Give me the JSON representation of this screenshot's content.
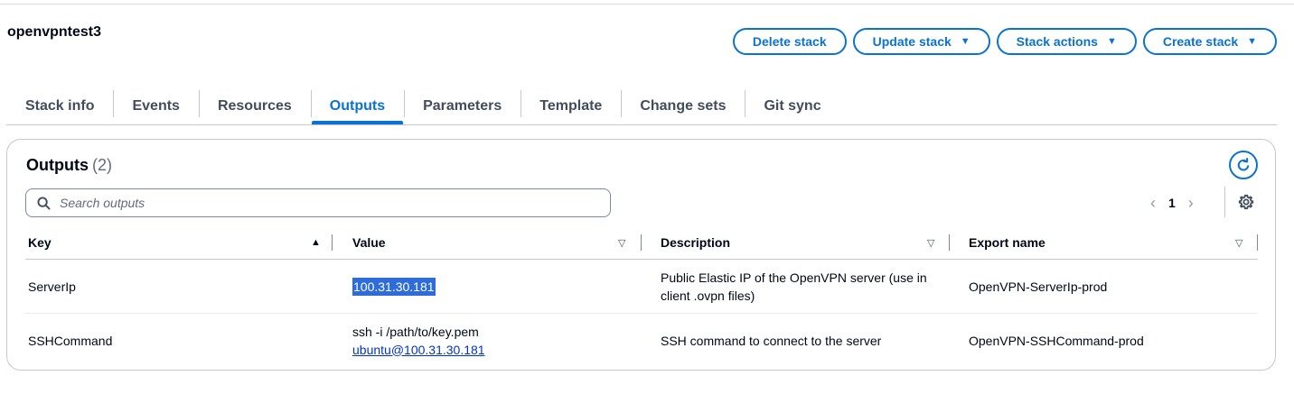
{
  "stack": {
    "name": "openvpntest3"
  },
  "actions": {
    "delete": "Delete stack",
    "update": "Update stack",
    "stack_actions": "Stack actions",
    "create": "Create stack",
    "caret": "▼"
  },
  "tabs": [
    {
      "label": "Stack info"
    },
    {
      "label": "Events"
    },
    {
      "label": "Resources"
    },
    {
      "label": "Outputs",
      "active": true
    },
    {
      "label": "Parameters"
    },
    {
      "label": "Template"
    },
    {
      "label": "Change sets"
    },
    {
      "label": "Git sync"
    }
  ],
  "outputs": {
    "title": "Outputs",
    "count": "(2)",
    "search_placeholder": "Search outputs",
    "page": "1",
    "columns": {
      "key": "Key",
      "value": "Value",
      "description": "Description",
      "export": "Export name"
    },
    "rows": [
      {
        "key": "ServerIp",
        "value_line1": "100.31.30.181",
        "description": "Public Elastic IP of the OpenVPN server (use in client .ovpn files)",
        "export": "OpenVPN-ServerIp-prod"
      },
      {
        "key": "SSHCommand",
        "value_line1": "ssh -i /path/to/key.pem",
        "value_line2": "ubuntu@100.31.30.181",
        "description": "SSH command to connect to the server",
        "export": "OpenVPN-SSHCommand-prod"
      }
    ]
  },
  "icons": {
    "sort_asc": "▲",
    "sort_desc": "▽",
    "prev": "‹",
    "next": "›"
  },
  "colors": {
    "accent": "#0972d3",
    "highlight": "#2e6dd9"
  }
}
